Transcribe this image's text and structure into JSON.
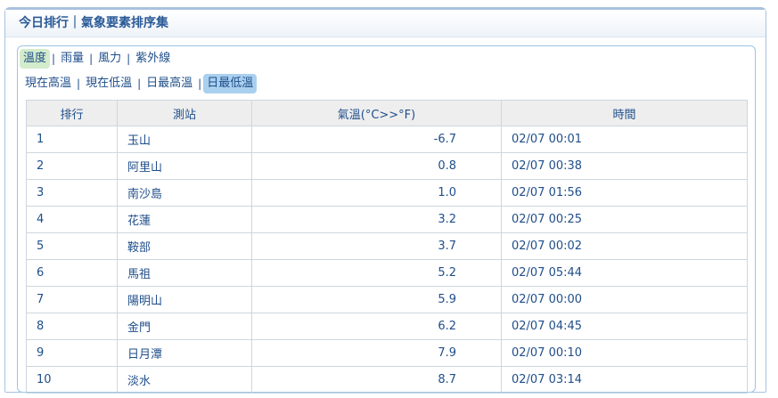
{
  "header": {
    "title": "今日排行｜氣象要素排序集"
  },
  "tabs_primary": [
    {
      "label": "溫度",
      "active": true
    },
    {
      "label": "雨量",
      "active": false
    },
    {
      "label": "風力",
      "active": false
    },
    {
      "label": "紫外線",
      "active": false
    }
  ],
  "tabs_secondary": [
    {
      "label": "現在高溫",
      "active": false
    },
    {
      "label": "現在低溫",
      "active": false
    },
    {
      "label": "日最高溫",
      "active": false
    },
    {
      "label": "日最低溫",
      "active": true
    }
  ],
  "table": {
    "columns": [
      "排行",
      "測站",
      "氣溫(°C>>°F)",
      "時間"
    ],
    "rows": [
      [
        "1",
        "玉山",
        "-6.7",
        "02/07 00:01"
      ],
      [
        "2",
        "阿里山",
        "0.8",
        "02/07 00:38"
      ],
      [
        "3",
        "南沙島",
        "1.0",
        "02/07 01:56"
      ],
      [
        "4",
        "花蓮",
        "3.2",
        "02/07 00:25"
      ],
      [
        "5",
        "鞍部",
        "3.7",
        "02/07 00:02"
      ],
      [
        "6",
        "馬祖",
        "5.2",
        "02/07 05:44"
      ],
      [
        "7",
        "陽明山",
        "5.9",
        "02/07 00:00"
      ],
      [
        "8",
        "金門",
        "6.2",
        "02/07 04:45"
      ],
      [
        "9",
        "日月潭",
        "7.9",
        "02/07 00:10"
      ],
      [
        "10",
        "淡水",
        "8.7",
        "02/07 03:14"
      ]
    ]
  },
  "colors": {
    "accent": "#1f4e8a",
    "active_tab_primary": "#d3eccb",
    "active_tab_secondary": "#aad0ef",
    "border": "#9cc5e4"
  }
}
